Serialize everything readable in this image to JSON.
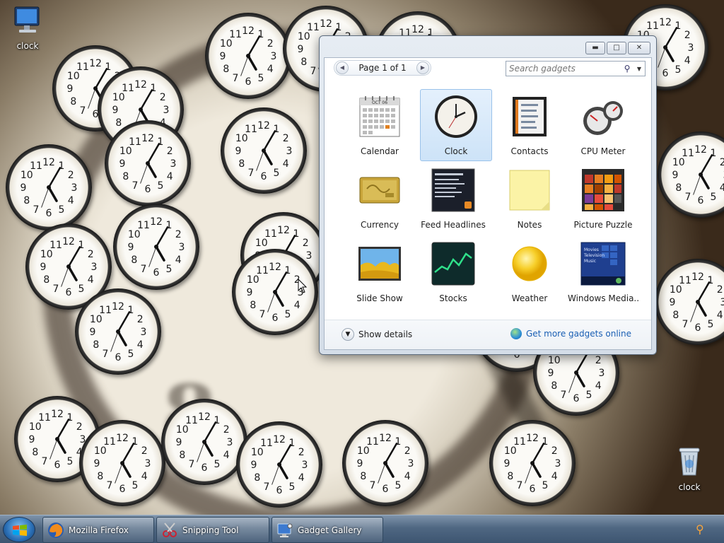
{
  "desktop": {
    "icons": [
      {
        "label": "clock",
        "icon": "computer-icon"
      },
      {
        "label": "clock",
        "icon": "recycle-bin-icon"
      }
    ]
  },
  "gallery": {
    "pager_label": "Page 1 of 1",
    "search_placeholder": "Search gadgets",
    "gadgets": [
      {
        "label": "Calendar",
        "icon": "calendar-icon"
      },
      {
        "label": "Clock",
        "icon": "clock-icon",
        "selected": true
      },
      {
        "label": "Contacts",
        "icon": "contacts-icon"
      },
      {
        "label": "CPU Meter",
        "icon": "cpu-meter-icon"
      },
      {
        "label": "Currency",
        "icon": "currency-icon"
      },
      {
        "label": "Feed Headlines",
        "icon": "feed-headlines-icon"
      },
      {
        "label": "Notes",
        "icon": "notes-icon"
      },
      {
        "label": "Picture Puzzle",
        "icon": "picture-puzzle-icon"
      },
      {
        "label": "Slide Show",
        "icon": "slide-show-icon"
      },
      {
        "label": "Stocks",
        "icon": "stocks-icon"
      },
      {
        "label": "Weather",
        "icon": "weather-icon"
      },
      {
        "label": "Windows Media...",
        "icon": "windows-media-icon"
      }
    ],
    "thumb_text": {
      "calendar_month": "OCT 06",
      "media_lines": [
        "Movies",
        "Television",
        "Music"
      ]
    },
    "show_details": "Show details",
    "get_more": "Get more gadgets online"
  },
  "taskbar": {
    "items": [
      {
        "label": "Mozilla Firefox",
        "icon": "firefox-icon"
      },
      {
        "label": "Snipping Tool",
        "icon": "snipping-tool-icon"
      },
      {
        "label": "Gadget Gallery",
        "icon": "gadget-gallery-icon"
      }
    ]
  },
  "clock_face": {
    "numbers": [
      "12",
      "1",
      "2",
      "3",
      "4",
      "5",
      "6",
      "7",
      "8",
      "9",
      "10",
      "11"
    ]
  }
}
